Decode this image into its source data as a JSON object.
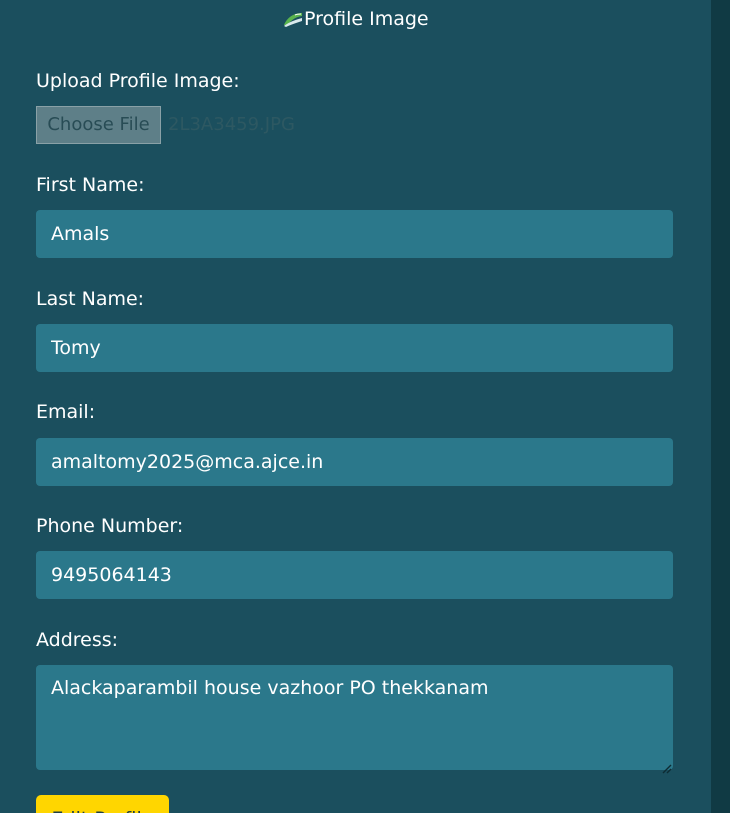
{
  "colors": {
    "page_background": "#1b4f5e",
    "right_strip": "#103a44",
    "field_background": "#2b788b",
    "label_text": "#ffffff",
    "field_text": "#ffffff",
    "file_button_background": "#5e7f88",
    "file_button_text": "#284c55",
    "file_name_text": "#2d5862",
    "primary_button": "#ffd600",
    "primary_button_text": "#1f3f46"
  },
  "profile_image": {
    "alt_text": "Profile Image",
    "icon": "broken-image-icon"
  },
  "upload": {
    "label": "Upload Profile Image:",
    "button_label": "Choose File",
    "file_name": "2L3A3459.JPG"
  },
  "first_name": {
    "label": "First Name:",
    "value": "Amals"
  },
  "last_name": {
    "label": "Last Name:",
    "value": "Tomy"
  },
  "email": {
    "label": "Email:",
    "value": "amaltomy2025@mca.ajce.in"
  },
  "phone": {
    "label": "Phone Number:",
    "value": "9495064143"
  },
  "address": {
    "label": "Address:",
    "value": "Alackaparambil house vazhoor PO thekkanam",
    "resize_icon": "resize-handle-icon"
  },
  "actions": {
    "edit_profile_label": "Edit Profile"
  }
}
